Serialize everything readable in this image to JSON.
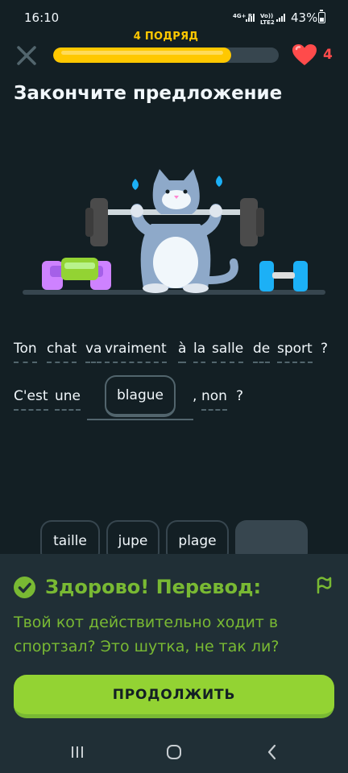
{
  "status_bar": {
    "time": "16:10",
    "network_label_top": "4G+ R",
    "network_label_volte": "Vo))",
    "network_label_lte": "LTE2",
    "battery_percent": "43%"
  },
  "header": {
    "close_icon": "close-icon",
    "streak_label": "4 ПОДРЯД",
    "progress_fraction": 0.79,
    "hearts_count": "4",
    "heart_icon": "heart-icon"
  },
  "title": "Закончите предложение",
  "exercise": {
    "line1_words": [
      "Ton",
      "chat",
      "va",
      "vraiment",
      "à",
      "la",
      "salle",
      "de",
      "sport",
      "?"
    ],
    "line2_prefix_words": [
      "C'est",
      "une"
    ],
    "answer_word": "blague",
    "line2_suffix_words": [
      ",",
      "non",
      "?"
    ],
    "word_bank": [
      "taille",
      "jupe",
      "plage"
    ]
  },
  "feedback": {
    "title": "Здорово! Перевод:",
    "text": "Твой кот действительно ходит в спортзал? Это шутка, не так ли?",
    "continue_label": "ПРОДОЛЖИТЬ"
  },
  "colors": {
    "background": "#131f24",
    "panel": "#202f36",
    "accent_green": "#79b933",
    "button_green": "#93d333",
    "streak_yellow": "#ffc800",
    "heart_red": "#ff4b4b"
  }
}
